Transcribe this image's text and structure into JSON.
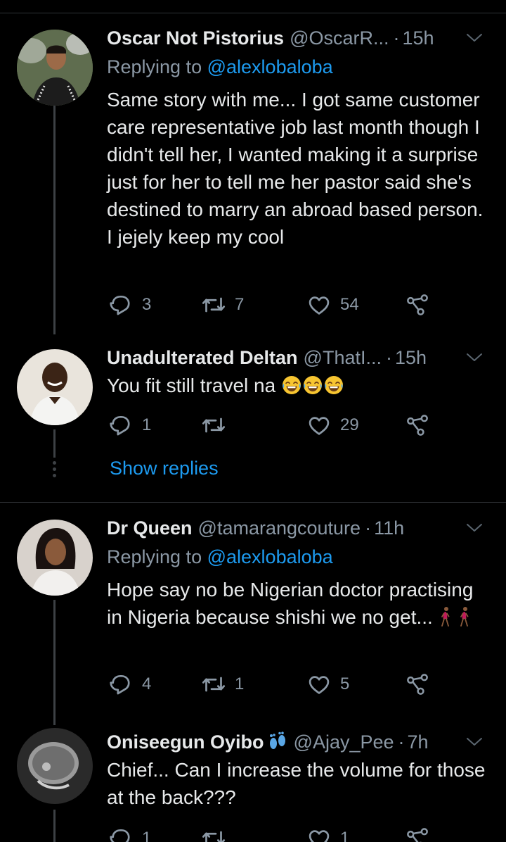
{
  "tweets": [
    {
      "name": "Oscar Not Pistorius",
      "handle": "@OscarR...",
      "time": "15h",
      "replying_label": "Replying to",
      "replying_to": "@alexlobaloba",
      "text": "Same story with me... I got same customer care representative job last month though I didn't tell her, I wanted making it a surprise just for her to tell me her pastor said she's destined to marry an abroad based person. I jejely keep my cool",
      "replies": "3",
      "retweets": "7",
      "likes": "54"
    },
    {
      "name": "Unadulterated Deltan",
      "handle": "@ThatI...",
      "time": "15h",
      "text": "You fit still travel na",
      "replies": "1",
      "retweets": "",
      "likes": "29",
      "show_replies": "Show replies"
    },
    {
      "name": "Dr Queen",
      "handle": "@tamarangcouture",
      "time": "11h",
      "replying_label": "Replying to",
      "replying_to": "@alexlobaloba",
      "text": "Hope say no be Nigerian doctor practising in Nigeria because shishi we no get...",
      "replies": "4",
      "retweets": "1",
      "likes": "5"
    },
    {
      "name": "Oniseegun Oyibo",
      "handle": "@Ajay_Pee",
      "time": "7h",
      "text": "Chief... Can I increase the volume for those at the back???",
      "replies": "1",
      "retweets": "",
      "likes": "1"
    }
  ],
  "colors": {
    "background": "#000000",
    "text": "#e7e9ea",
    "muted": "#8b98a5",
    "link": "#1d9bf0"
  },
  "icons": [
    "reply-icon",
    "retweet-icon",
    "like-icon",
    "share-icon",
    "chevron-down-icon",
    "laughing-emoji-icon",
    "walking-woman-emoji-icon",
    "footprints-emoji-icon"
  ]
}
